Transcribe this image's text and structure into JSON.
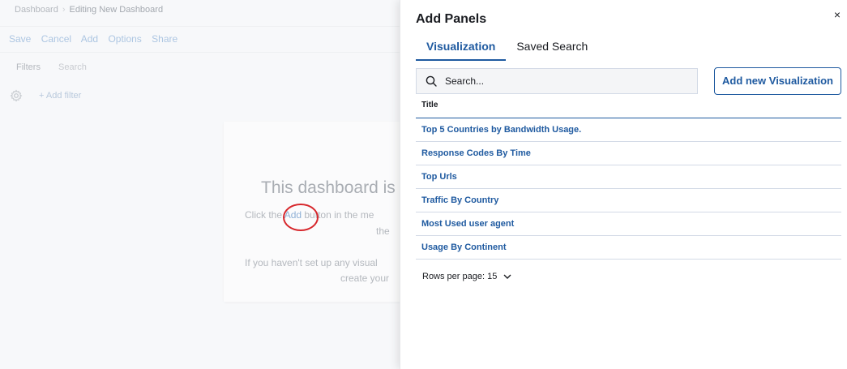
{
  "background": {
    "breadcrumbs": [
      "Dashboard",
      "Editing New Dashboard"
    ],
    "top_menu": [
      "Save",
      "Cancel",
      "Add",
      "Options",
      "Share"
    ],
    "query_bar": {
      "filters_label": "Filters",
      "search_placeholder": "Search"
    },
    "add_filter": "+ Add filter",
    "empty_state": {
      "title": "This dashboard is",
      "line1_prefix": "Click the ",
      "line1_link": "Add",
      "line1_suffix": " button in the me",
      "line2": "the",
      "line3": "If you haven't set up any visual",
      "line4": "create your"
    }
  },
  "flyout": {
    "title": "Add Panels",
    "close_glyph": "×",
    "tabs": [
      {
        "label": "Visualization",
        "active": true
      },
      {
        "label": "Saved Search",
        "active": false
      }
    ],
    "search": {
      "placeholder": "Search...",
      "value": ""
    },
    "add_button_label": "Add new Visualization",
    "column_title": "Title",
    "rows": [
      "Top 5 Countries by Bandwidth Usage.",
      "Response Codes By Time",
      "Top Urls",
      "Traffic By Country",
      "Most Used user agent",
      "Usage By Continent"
    ],
    "rows_per_page_label": "Rows per page: 15"
  },
  "colors": {
    "accent": "#1f5aa0",
    "annotation": "#d7262b",
    "dimmed_text": "#b4b8be"
  }
}
